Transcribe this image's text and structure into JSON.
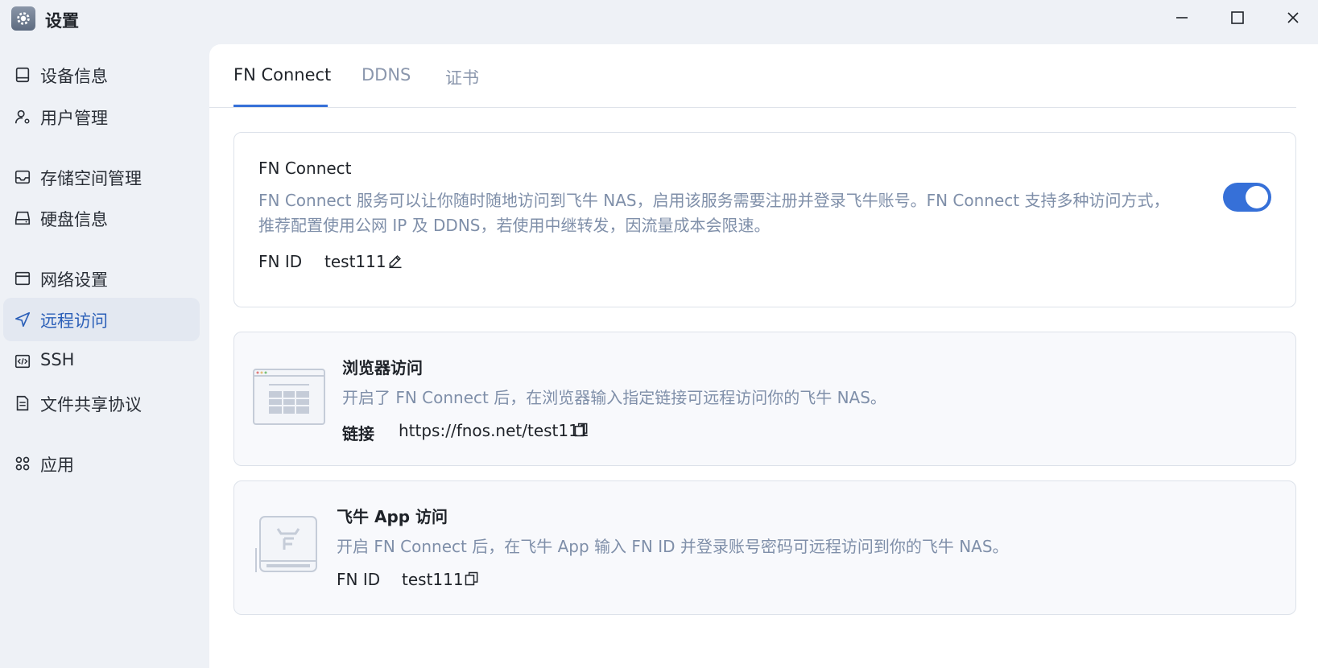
{
  "window": {
    "title": "设置",
    "app_icon": "gear-icon",
    "controls": [
      "minimize-icon",
      "maximize-icon",
      "close-icon"
    ]
  },
  "sidebar": {
    "items": [
      {
        "label": "设备信息",
        "icon": "monitor-icon"
      },
      {
        "label": "用户管理",
        "icon": "user-gear-icon"
      },
      {
        "label": "存储空间管理",
        "icon": "inbox-icon"
      },
      {
        "label": "硬盘信息",
        "icon": "drive-icon"
      },
      {
        "label": "网络设置",
        "icon": "window-icon"
      },
      {
        "label": "远程访问",
        "icon": "send-icon",
        "active": true
      },
      {
        "label": "SSH",
        "icon": "code-icon"
      },
      {
        "label": "文件共享协议",
        "icon": "document-icon"
      },
      {
        "label": "应用",
        "icon": "apps-icon"
      }
    ]
  },
  "tabs": [
    {
      "label": "FN Connect",
      "active": true
    },
    {
      "label": "DDNS"
    },
    {
      "label": "证书"
    }
  ],
  "fn_connect": {
    "title": "FN Connect",
    "desc_line1": "FN Connect 服务可以让你随时随地访问到飞牛 NAS，启用该服务需要注册并登录飞牛账号。FN Connect 支持多种访问方式，",
    "desc_line2": "推荐配置使用公网 IP 及 DDNS，若使用中继转发，因流量成本会限速。",
    "id_label": "FN ID",
    "id_value": "test111",
    "enabled": true
  },
  "browser_access": {
    "title": "浏览器访问",
    "desc": "开启了 FN Connect 后，在浏览器输入指定链接可远程访问你的飞牛 NAS。",
    "link_label": "链接",
    "link_value": "https://fnos.net/test111"
  },
  "app_access": {
    "title": "飞牛 App 访问",
    "desc": "开启 FN Connect 后，在飞牛 App 输入 FN ID 并登录账号密码可远程访问到你的飞牛 NAS。",
    "id_label": "FN ID",
    "id_value": "test111"
  },
  "colors": {
    "accent": "#3670d8",
    "sidebar_bg": "#eef1f6",
    "active_text": "#2b5fb8",
    "muted_text": "#7f8fa9"
  }
}
